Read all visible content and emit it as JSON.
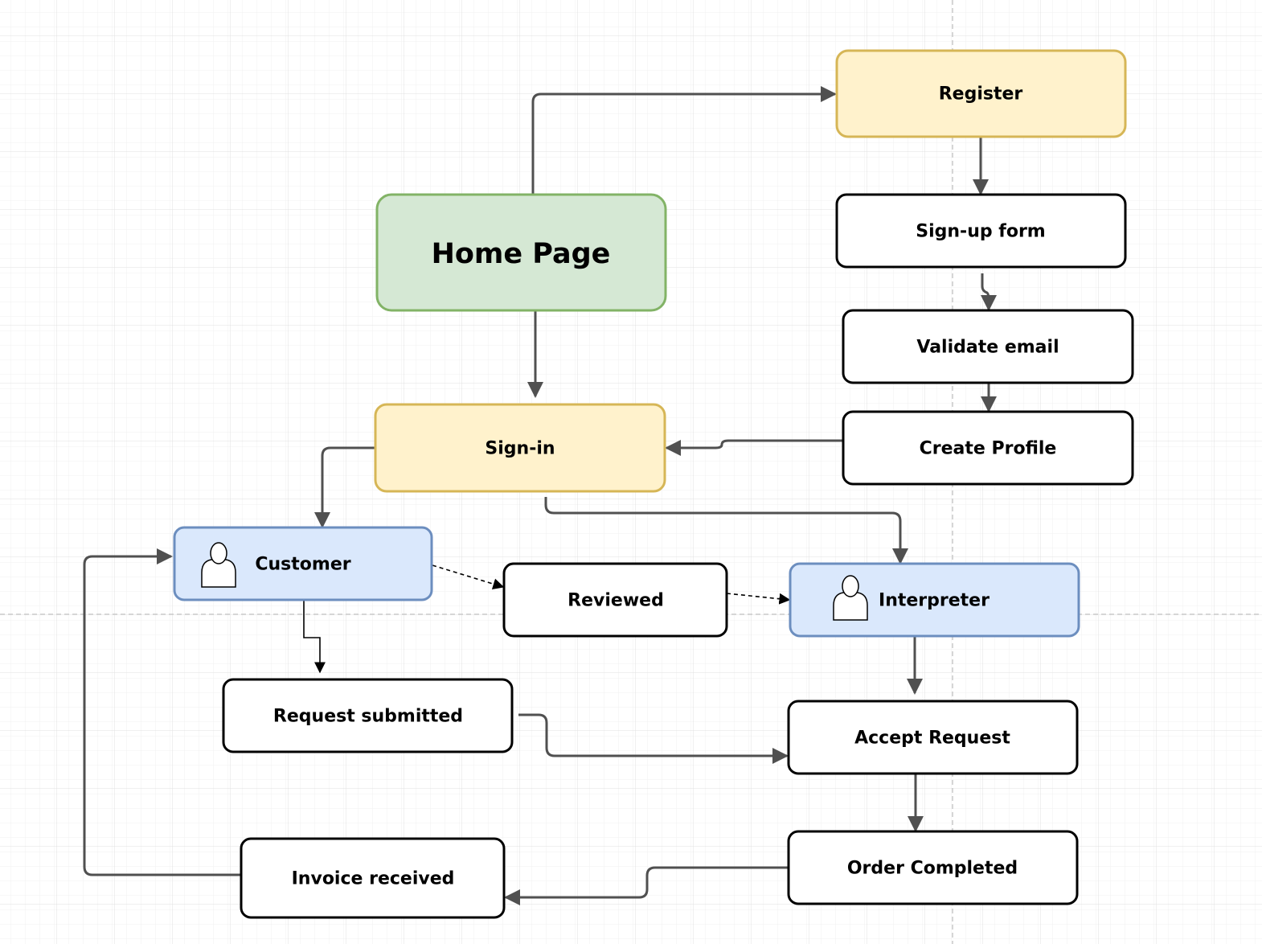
{
  "diagram": {
    "colors": {
      "yellow_fill": "#fff2cc",
      "yellow_stroke": "#d6b656",
      "green_fill": "#d5e8d4",
      "green_stroke": "#82b366",
      "blue_fill": "#dae8fc",
      "blue_stroke": "#6c8ebf",
      "edge": "#505050"
    },
    "nodes": {
      "register": "Register",
      "home": "Home Page",
      "signup": "Sign-up form",
      "validate": "Validate email",
      "profile": "Create Profile",
      "signin": "Sign-in",
      "customer": "Customer",
      "reviewed": "Reviewed",
      "interpreter": "Interpreter",
      "request": "Request submitted",
      "accept": "Accept Request",
      "order": "Order Completed",
      "invoice": "Invoice received"
    },
    "icons": {
      "customer": "user-icon",
      "interpreter": "user-icon"
    }
  }
}
